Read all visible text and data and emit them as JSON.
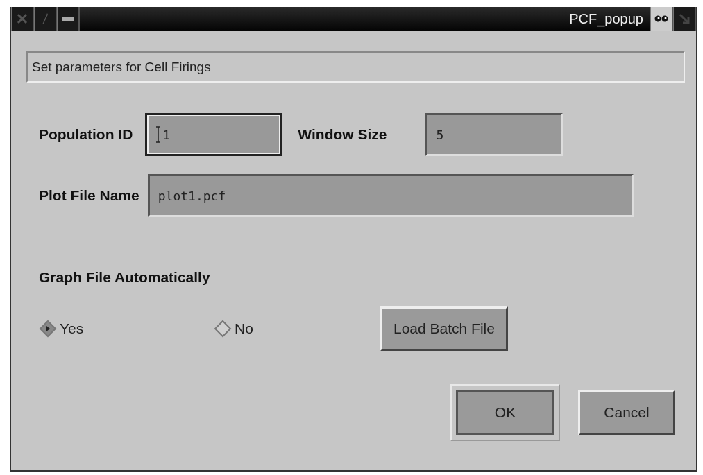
{
  "window": {
    "title": "PCF_popup"
  },
  "message": "Set parameters for Cell Firings",
  "fields": [
    {
      "label": "Population ID",
      "value": "1",
      "focused": true
    },
    {
      "label": "Window Size",
      "value": "5",
      "focused": false
    },
    {
      "label": "Plot File Name",
      "value": "plot1.pcf",
      "focused": false
    }
  ],
  "graph_option": {
    "label": "Graph File Automatically",
    "options": [
      {
        "label": "Yes",
        "selected": true
      },
      {
        "label": "No",
        "selected": false
      }
    ]
  },
  "batch_button": "Load Batch File",
  "buttons": [
    {
      "label": "OK",
      "default": true
    },
    {
      "label": "Cancel",
      "default": false
    }
  ]
}
